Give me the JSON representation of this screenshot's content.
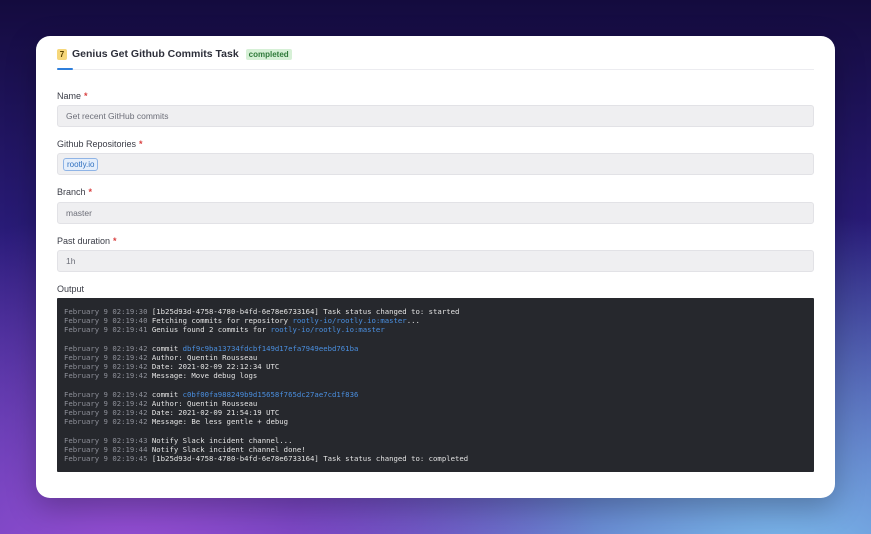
{
  "task": {
    "number": "7",
    "title": "Genius Get Github Commits Task",
    "status": "completed"
  },
  "form": {
    "name": {
      "label": "Name",
      "value": "Get recent GitHub commits"
    },
    "repos": {
      "label": "Github Repositories",
      "chip": "rootly.io"
    },
    "branch": {
      "label": "Branch",
      "value": "master"
    },
    "duration": {
      "label": "Past duration",
      "value": "1h"
    },
    "output_label": "Output"
  },
  "log": [
    {
      "ts": "February 9 02:19:30",
      "pre": " [1b25d93d-4758-4780-b4fd-6e78e6733164] Task status changed to: started",
      "link": "",
      "post": ""
    },
    {
      "ts": "February 9 02:19:40",
      "pre": " Fetching commits for repository ",
      "link": "rootly-io/rootly.io:master",
      "post": "..."
    },
    {
      "ts": "February 9 02:19:41",
      "pre": " Genius found 2 commits for ",
      "link": "rootly-io/rootly.io:master",
      "post": ""
    },
    {
      "blank": true
    },
    {
      "ts": "February 9 02:19:42",
      "pre": " commit ",
      "link": "dbf9c9ba13734fdcbf149d17efa7949eebd761ba",
      "post": ""
    },
    {
      "ts": "February 9 02:19:42",
      "pre": " Author: Quentin Rousseau",
      "link": "",
      "post": ""
    },
    {
      "ts": "February 9 02:19:42",
      "pre": " Date: 2021-02-09 22:12:34 UTC",
      "link": "",
      "post": ""
    },
    {
      "ts": "February 9 02:19:42",
      "pre": " Message: Move debug logs",
      "link": "",
      "post": ""
    },
    {
      "blank": true
    },
    {
      "ts": "February 9 02:19:42",
      "pre": " commit ",
      "link": "c0bf00fa988249b9d15658f765dc27ae7cd1f836",
      "post": ""
    },
    {
      "ts": "February 9 02:19:42",
      "pre": " Author: Quentin Rousseau",
      "link": "",
      "post": ""
    },
    {
      "ts": "February 9 02:19:42",
      "pre": " Date: 2021-02-09 21:54:19 UTC",
      "link": "",
      "post": ""
    },
    {
      "ts": "February 9 02:19:42",
      "pre": " Message: Be less gentle + debug",
      "link": "",
      "post": ""
    },
    {
      "blank": true
    },
    {
      "ts": "February 9 02:19:43",
      "pre": " Notify Slack incident channel...",
      "link": "",
      "post": ""
    },
    {
      "ts": "February 9 02:19:44",
      "pre": " Notify Slack incident channel done!",
      "link": "",
      "post": ""
    },
    {
      "ts": "February 9 02:19:45",
      "pre": " [1b25d93d-4758-4780-b4fd-6e78e6733164] Task status changed to: completed",
      "link": "",
      "post": ""
    }
  ]
}
